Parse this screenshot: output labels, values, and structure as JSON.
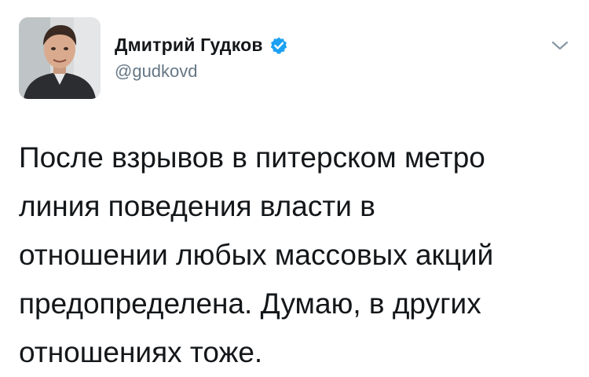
{
  "author": {
    "display_name": "Дмитрий Гудков",
    "handle": "@gudkovd",
    "verified": true
  },
  "tweet": {
    "lines": [
      "После взрывов в питерском метро",
      "линия поведения власти в",
      "отношении любых массовых акций",
      "предопределена. Думаю, в других",
      "отношениях тоже."
    ]
  },
  "icons": {
    "verified": "verified-badge-icon",
    "menu": "chevron-down-icon"
  },
  "colors": {
    "verified_blue": "#1da1f2",
    "handle_gray": "#657786",
    "text": "#14171a"
  }
}
